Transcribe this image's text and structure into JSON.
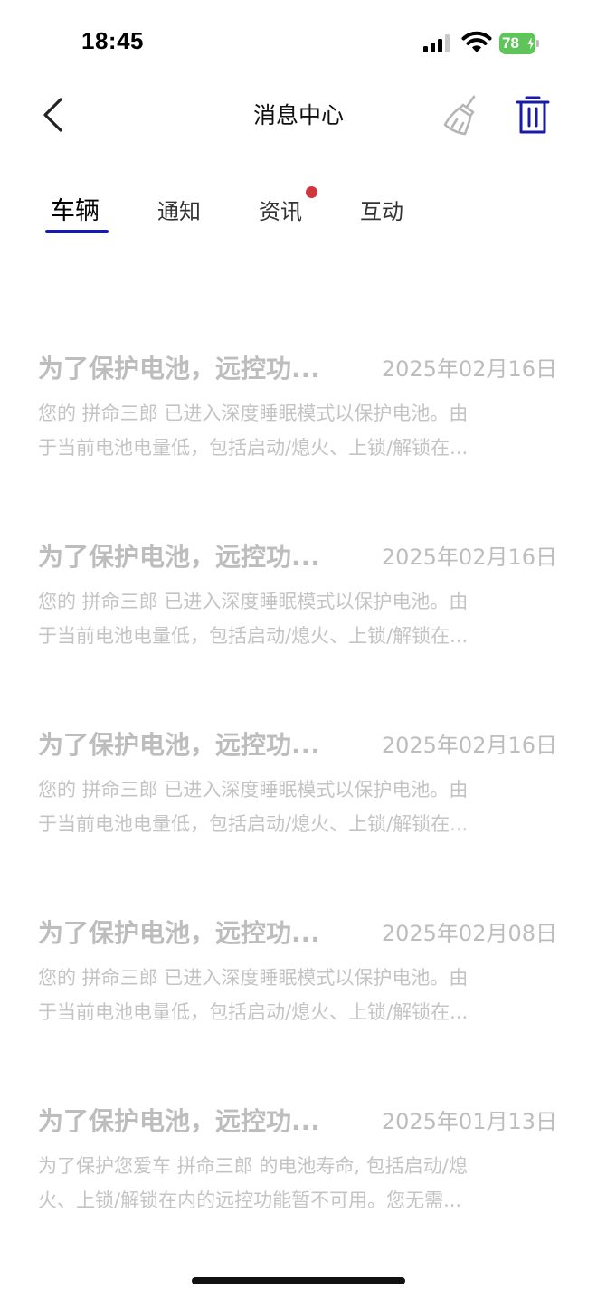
{
  "status_bar": {
    "time": "18:45",
    "battery_level": "78"
  },
  "header": {
    "title": "消息中心",
    "back_icon": "chevron-left-icon",
    "clean_icon": "broom-icon",
    "trash_icon": "trash-icon",
    "accent_color": "#1a1aa8"
  },
  "tabs": [
    {
      "label": "车辆",
      "active": true
    },
    {
      "label": "通知",
      "active": false
    },
    {
      "label": "资讯",
      "active": false,
      "badge": true
    },
    {
      "label": "互动",
      "active": false
    }
  ],
  "messages": [
    {
      "title": "为了保护电池，远控功...",
      "date": "2025年02月16日",
      "body_line1": "您的 拼命三郎 已进入深度睡眠模式以保护电池。由",
      "body_line2": "于当前电池电量低，包括启动/熄火、上锁/解锁在..."
    },
    {
      "title": "为了保护电池，远控功...",
      "date": "2025年02月16日",
      "body_line1": "您的 拼命三郎 已进入深度睡眠模式以保护电池。由",
      "body_line2": "于当前电池电量低，包括启动/熄火、上锁/解锁在..."
    },
    {
      "title": "为了保护电池，远控功...",
      "date": "2025年02月16日",
      "body_line1": "您的 拼命三郎 已进入深度睡眠模式以保护电池。由",
      "body_line2": "于当前电池电量低，包括启动/熄火、上锁/解锁在..."
    },
    {
      "title": "为了保护电池，远控功...",
      "date": "2025年02月08日",
      "body_line1": "您的 拼命三郎 已进入深度睡眠模式以保护电池。由",
      "body_line2": "于当前电池电量低，包括启动/熄火、上锁/解锁在..."
    },
    {
      "title": "为了保护电池，远控功...",
      "date": "2025年01月13日",
      "body_line1": "为了保护您爱车 拼命三郎 的电池寿命, 包括启动/熄",
      "body_line2": "火、上锁/解锁在内的远控功能暂不可用。您无需..."
    }
  ]
}
